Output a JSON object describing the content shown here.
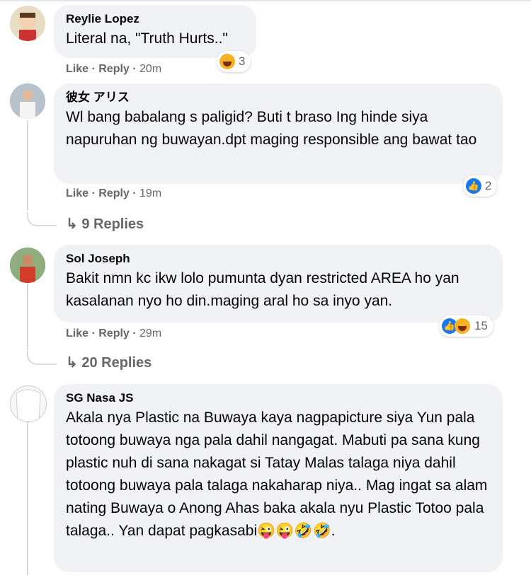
{
  "comments": [
    {
      "author": "Reylie Lopez",
      "text": "Literal na, \"Truth Hurts..\"",
      "like": "Like",
      "reply": "Reply",
      "time": "20m",
      "reaction_count": "3",
      "reaction_icons": [
        "haha-icon"
      ]
    },
    {
      "author": "彼女 アリス",
      "text": "Wl bang babalang s paligid? Buti t braso Ing hinde siya napuruhan ng buwayan.dpt maging responsible ang bawat tao",
      "like": "Like",
      "reply": "Reply",
      "time": "19m",
      "reaction_count": "2",
      "reaction_icons": [
        "like-icon"
      ],
      "replies_label": "9 Replies"
    },
    {
      "author": "Sol Joseph",
      "text": "Bakit nmn kc ikw lolo pumunta dyan restricted AREA ho yan kasalanan nyo ho din.maging aral ho sa inyo yan.",
      "like": "Like",
      "reply": "Reply",
      "time": "29m",
      "reaction_count": "15",
      "reaction_icons": [
        "like-icon",
        "haha-icon"
      ],
      "replies_label": "20 Replies"
    },
    {
      "author": "SG Nasa JS",
      "text": "Akala nya Plastic na Buwaya kaya nagpapicture siya Yun pala totoong buwaya nga pala dahil nangagat. Mabuti pa sana kung plastic nuh di sana nakagat si Tatay Malas talaga niya dahil totoong buwaya pala talaga nakaharap niya.. Mag ingat sa alam nating Buwaya o Anong Ahas baka akala nyu Plastic Totoo pala talaga.. Yan dapat pagkasabi😜😜🤣🤣."
    }
  ],
  "colors": {
    "bubble": "#f0f2f5",
    "meta": "#65676b",
    "like_blue": "#1877f2",
    "haha_yellow": "#f7b125"
  }
}
